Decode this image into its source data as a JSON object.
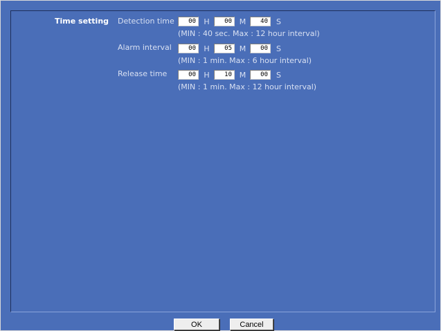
{
  "section": {
    "title": "Time setting"
  },
  "rows": [
    {
      "label": "Detection time",
      "hours": "00",
      "minutes": "00",
      "seconds": "40",
      "hint": "(MIN : 40 sec. Max : 12 hour interval)"
    },
    {
      "label": "Alarm interval",
      "hours": "00",
      "minutes": "05",
      "seconds": "00",
      "hint": "(MIN : 1 min. Max : 6 hour interval)"
    },
    {
      "label": "Release time",
      "hours": "00",
      "minutes": "10",
      "seconds": "00",
      "hint": "(MIN : 1 min. Max : 12 hour interval)"
    }
  ],
  "units": {
    "hours": "H",
    "minutes": "M",
    "seconds": "S"
  },
  "buttons": {
    "ok": "OK",
    "cancel": "Cancel"
  },
  "colors": {
    "background": "#4a6eb8",
    "text": "#d8e0f2",
    "title": "#ffffff"
  }
}
